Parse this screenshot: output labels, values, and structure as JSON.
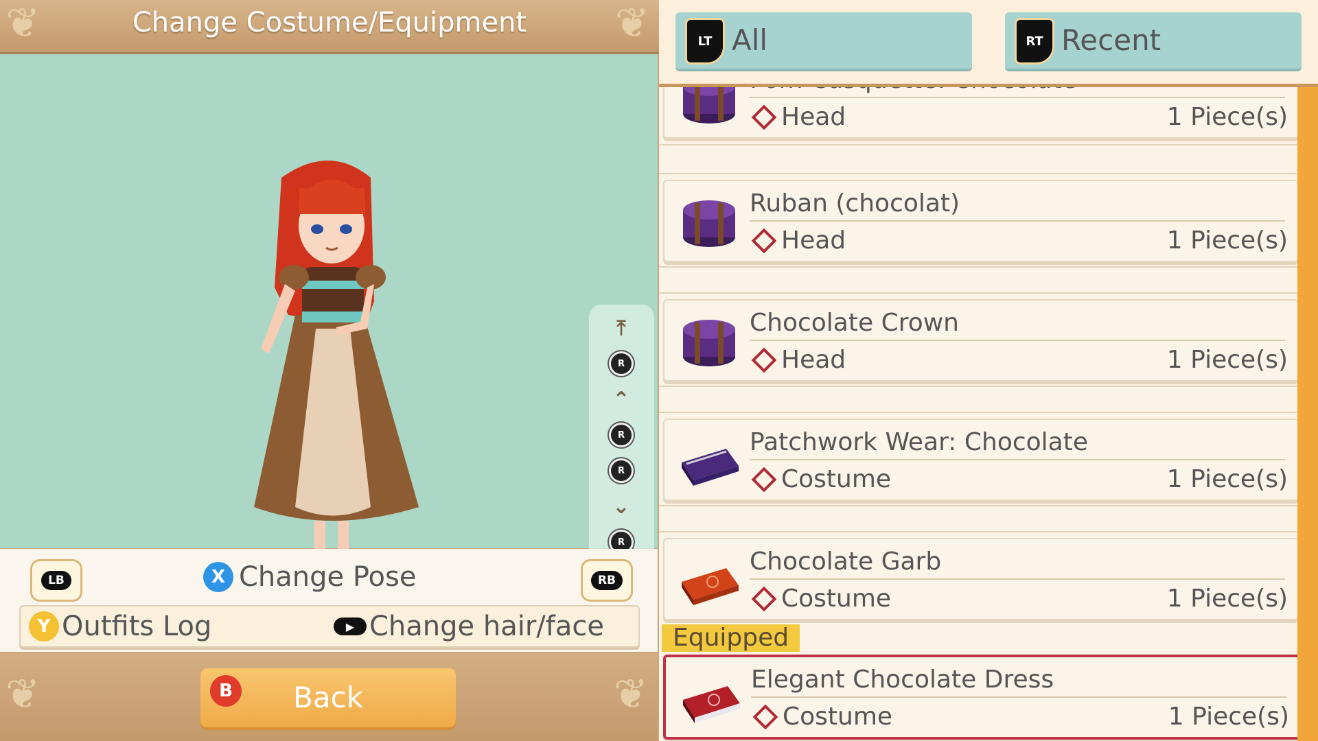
{
  "left_panel": {
    "title": "Change Costume/Equipment",
    "controls": {
      "lb_label": "LB",
      "rb_label": "RB",
      "x_button": "X",
      "change_pose": "Change Pose",
      "y_button": "Y",
      "outfits_log": "Outfits Log",
      "change_hair_face": "Change hair/face"
    },
    "back": {
      "b_button": "B",
      "label": "Back"
    },
    "camera_controls": [
      "top-icon",
      "rs-up",
      "up-icon",
      "rs-left",
      "rs-right",
      "down-icon",
      "rs-down",
      "bottom-icon"
    ]
  },
  "right_panel": {
    "filters": [
      {
        "trigger": "LT",
        "label": "All"
      },
      {
        "trigger": "RT",
        "label": "Recent"
      }
    ],
    "items": [
      {
        "name": "Pom Casquette: Chocolate",
        "category": "Head",
        "qty": "1 Piece(s)",
        "icon": "purple-hatbox-icon"
      },
      {
        "name": "Ruban (chocolat)",
        "category": "Head",
        "qty": "1 Piece(s)",
        "icon": "purple-hatbox-icon"
      },
      {
        "name": "Chocolate Crown",
        "category": "Head",
        "qty": "1 Piece(s)",
        "icon": "purple-hatbox-icon"
      },
      {
        "name": "Patchwork Wear: Chocolate",
        "category": "Costume",
        "qty": "1 Piece(s)",
        "icon": "purple-suitcase-icon"
      },
      {
        "name": "Chocolate Garb",
        "category": "Costume",
        "qty": "1 Piece(s)",
        "icon": "orange-suitcase-icon"
      },
      {
        "name": "Elegant Chocolate Dress",
        "category": "Costume",
        "qty": "1 Piece(s)",
        "icon": "red-suitcase-icon"
      }
    ],
    "equipped_label": "Equipped",
    "colors": {
      "hatbox": "#5b2d82",
      "suitcase_purple": "#4a2a7a",
      "suitcase_orange": "#d2431a",
      "suitcase_red": "#b3202a",
      "equipped_border": "#c0324a"
    }
  }
}
